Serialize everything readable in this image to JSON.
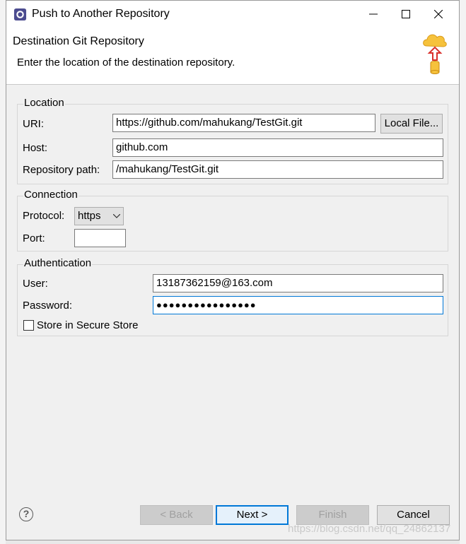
{
  "window": {
    "title": "Push to Another Repository"
  },
  "banner": {
    "title": "Destination Git Repository",
    "description": "Enter the location of the destination repository."
  },
  "location": {
    "group_label": "Location",
    "uri_label": "URI:",
    "uri_value": "https://github.com/mahukang/TestGit.git",
    "local_file_label": "Local File...",
    "host_label": "Host:",
    "host_value": "github.com",
    "repo_path_label": "Repository path:",
    "repo_path_value": "/mahukang/TestGit.git"
  },
  "connection": {
    "group_label": "Connection",
    "protocol_label": "Protocol:",
    "protocol_value": "https",
    "port_label": "Port:",
    "port_value": ""
  },
  "authentication": {
    "group_label": "Authentication",
    "user_label": "User:",
    "user_value": "13187362159@163.com",
    "password_label": "Password:",
    "password_value": "●●●●●●●●●●●●●●●●",
    "store_label": "Store in Secure Store",
    "store_checked": false
  },
  "footer": {
    "back_label": "< Back",
    "next_label": "Next >",
    "finish_label": "Finish",
    "cancel_label": "Cancel",
    "help_glyph": "?"
  },
  "watermark": "https://blog.csdn.net/qq_24862137",
  "colors": {
    "focus_border": "#0078d7",
    "disabled_text": "#a0a0a0",
    "arrow_red": "#d9302c",
    "cloud_yellow": "#f6c23c"
  }
}
